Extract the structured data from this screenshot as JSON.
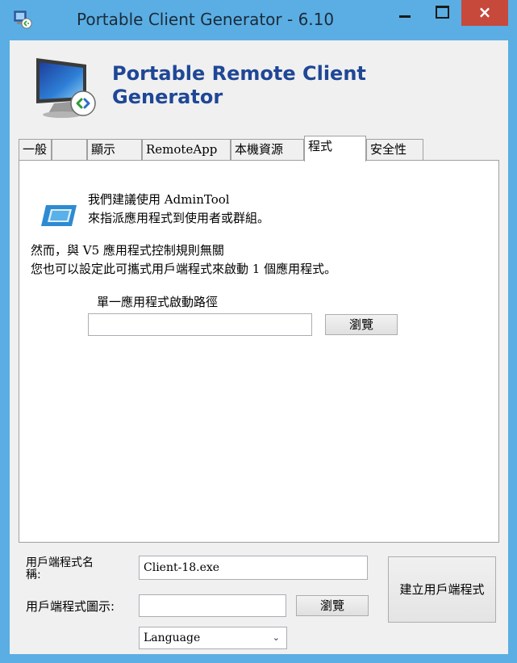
{
  "window": {
    "title": "Portable Client Generator - 6.10",
    "close_glyph": "×"
  },
  "header": {
    "title_line1": "Portable Remote Client",
    "title_line2": "Generator"
  },
  "tabs": [
    {
      "label": "一般",
      "active": false
    },
    {
      "label": "顯示",
      "active": false
    },
    {
      "label": "RemoteApp",
      "active": false
    },
    {
      "label": "本機資源",
      "active": false
    },
    {
      "label": "程式",
      "active": true
    },
    {
      "label": "安全性",
      "active": false
    }
  ],
  "program_tab": {
    "info_line1": "我們建議使用 AdminTool",
    "info_line2": "來指派應用程式到使用者或群組。",
    "note_line1": "然而，與 V5 應用程式控制規則無關",
    "note_line2": "您也可以設定此可攜式用戶端程式來啟動 1 個應用程式。",
    "path_label": "單一應用程式啟動路徑",
    "path_value": "",
    "browse_label": "瀏覽"
  },
  "footer": {
    "client_name_label_line1": "用戶端程式名",
    "client_name_label_line2": "稱:",
    "client_name_value": "Client-18.exe",
    "client_icon_label": "用戶端程式圖示:",
    "client_icon_value": "",
    "browse_label": "瀏覽",
    "language_selected": "Language",
    "build_button_label": "建立用戶端程式"
  },
  "colors": {
    "title_bar": "#5aaee3",
    "close_button": "#c7493c",
    "header_title": "#1f4796",
    "client_bg": "#f0f0f0"
  },
  "icons": {
    "app": "remote-desktop-icon",
    "header": "monitor-remote-icon",
    "info": "admintool-icon"
  }
}
